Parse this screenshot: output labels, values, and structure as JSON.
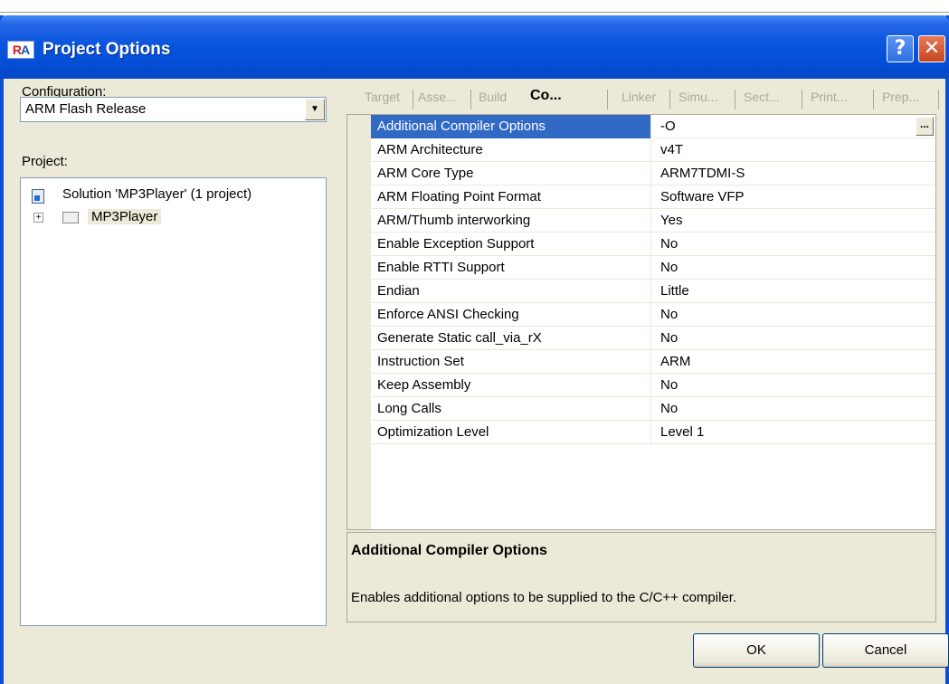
{
  "window": {
    "title": "Project Options",
    "app_icon": "RA-logo",
    "help_label": "?",
    "close_label": "✕"
  },
  "configuration": {
    "label": "Configuration:",
    "selected": "ARM Flash Release",
    "dropdown_arrow": "▼"
  },
  "project": {
    "label": "Project:",
    "tree": {
      "solution": "Solution 'MP3Player' (1 project)",
      "project_node": "MP3Player",
      "expand_glyph": "+"
    }
  },
  "tabs": [
    {
      "label": "Target"
    },
    {
      "label": "Asse..."
    },
    {
      "label": "Build"
    },
    {
      "label": "Co...",
      "active": true
    },
    {
      "label": "Linker"
    },
    {
      "label": "Simu..."
    },
    {
      "label": "Sect..."
    },
    {
      "label": "Print..."
    },
    {
      "label": "Prep..."
    }
  ],
  "properties": [
    {
      "name": "Additional Compiler Options",
      "value": "-O",
      "selected": true
    },
    {
      "name": "ARM Architecture",
      "value": "v4T"
    },
    {
      "name": "ARM Core Type",
      "value": "ARM7TDMI-S"
    },
    {
      "name": "ARM Floating Point Format",
      "value": "Software VFP"
    },
    {
      "name": "ARM/Thumb interworking",
      "value": "Yes"
    },
    {
      "name": "Enable Exception Support",
      "value": "No"
    },
    {
      "name": "Enable RTTI Support",
      "value": "No"
    },
    {
      "name": "Endian",
      "value": "Little"
    },
    {
      "name": "Enforce ANSI Checking",
      "value": "No"
    },
    {
      "name": "Generate Static call_via_rX",
      "value": "No"
    },
    {
      "name": "Instruction Set",
      "value": "ARM"
    },
    {
      "name": "Keep Assembly",
      "value": "No"
    },
    {
      "name": "Long Calls",
      "value": "No"
    },
    {
      "name": "Optimization Level",
      "value": "Level 1"
    }
  ],
  "ellipsis_label": "...",
  "description": {
    "title": "Additional Compiler Options",
    "text": "Enables additional options to be supplied to the C/C++ compiler."
  },
  "buttons": {
    "ok": "OK",
    "cancel": "Cancel"
  },
  "colors": {
    "titlebar": "#0855dd",
    "selection": "#316ac5",
    "dialog_bg": "#ece9d8"
  }
}
